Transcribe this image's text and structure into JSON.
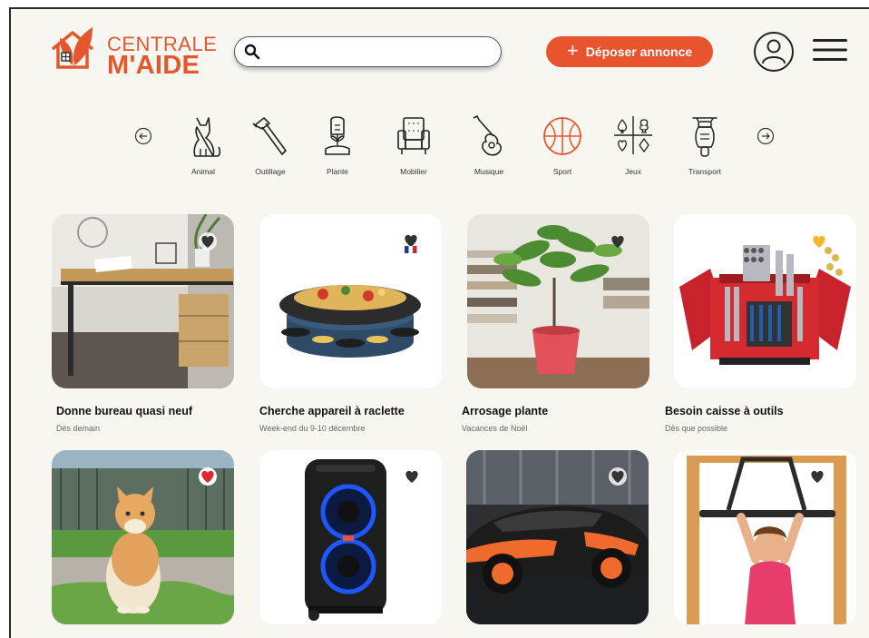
{
  "header": {
    "logo_line1": "CENTRALE",
    "logo_line2": "M'AIDE",
    "search_placeholder": "",
    "post_button_label": "Déposer annonce"
  },
  "categories": [
    {
      "label": "Animal",
      "icon": "cat-icon"
    },
    {
      "label": "Outillage",
      "icon": "hammer-icon"
    },
    {
      "label": "Plante",
      "icon": "plant-icon"
    },
    {
      "label": "Mobilier",
      "icon": "armchair-icon"
    },
    {
      "label": "Musique",
      "icon": "guitar-icon"
    },
    {
      "label": "Sport",
      "icon": "basketball-icon"
    },
    {
      "label": "Jeux",
      "icon": "card-suits-icon"
    },
    {
      "label": "Transport",
      "icon": "scooter-icon"
    }
  ],
  "accent_color": "#e8542e",
  "listings": [
    {
      "title": "Donne bureau quasi neuf",
      "subtitle": "Dès demain",
      "image": "desk-photo",
      "heart": "dark"
    },
    {
      "title": "Cherche appareil à raclette",
      "subtitle": "Week-end du 9-10 décembre",
      "image": "raclette-photo",
      "heart": "flag"
    },
    {
      "title": "Arrosage plante",
      "subtitle": "Vacances de Noël",
      "image": "plant-photo",
      "heart": "dark"
    },
    {
      "title": "Besoin caisse à outils",
      "subtitle": "Dès que possible",
      "image": "toolbox-photo",
      "heart": "yellow"
    },
    {
      "title": "",
      "subtitle": "",
      "image": "cat-photo",
      "heart": "red"
    },
    {
      "title": "",
      "subtitle": "",
      "image": "speaker-photo",
      "heart": "dark"
    },
    {
      "title": "",
      "subtitle": "",
      "image": "sports-car-photo",
      "heart": "dark"
    },
    {
      "title": "",
      "subtitle": "",
      "image": "pullup-bar-photo",
      "heart": "dark"
    }
  ]
}
